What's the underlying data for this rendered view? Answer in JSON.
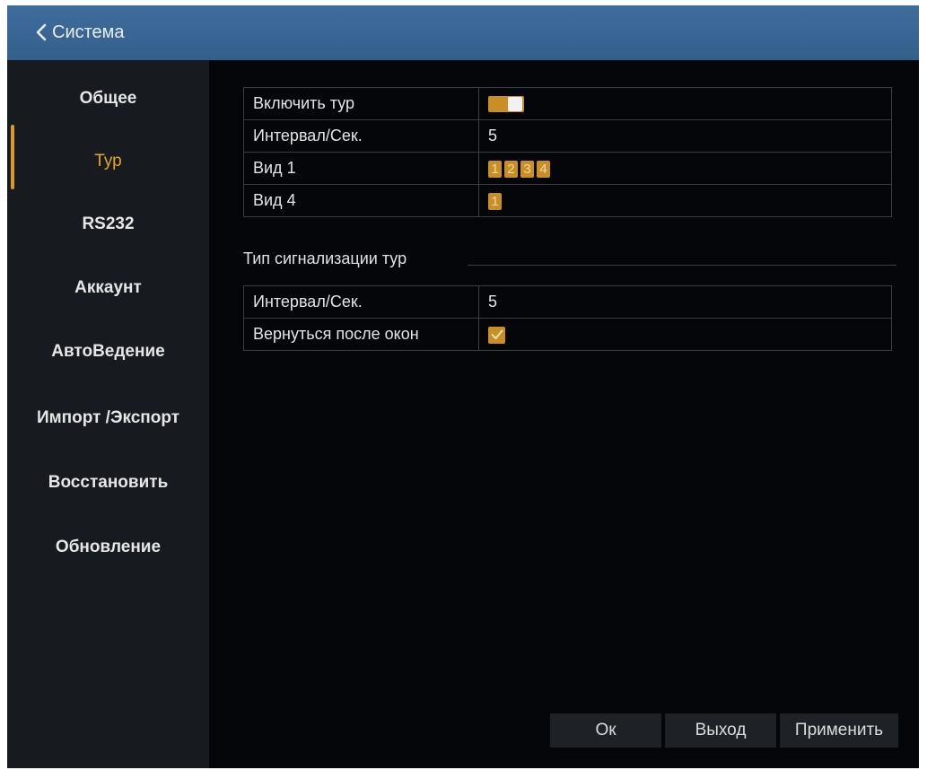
{
  "title_bar": {
    "back_icon": "chevron-left-icon",
    "title": "Система"
  },
  "sidebar": {
    "active_color": "#e3a52a",
    "items": [
      {
        "label": "Общее",
        "active": false
      },
      {
        "label": "Тур",
        "active": true
      },
      {
        "label": "RS232",
        "active": false
      },
      {
        "label": "Аккаунт",
        "active": false
      },
      {
        "label": "АвтоВедение",
        "active": false
      },
      {
        "label": "Импорт /Экспорт",
        "active": false
      },
      {
        "label": "Восстановить",
        "active": false
      },
      {
        "label": "Обновление",
        "active": false
      }
    ]
  },
  "tour": {
    "enable": {
      "label": "Включить тур",
      "on": true
    },
    "interval": {
      "label": "Интервал/Сек.",
      "value": "5"
    },
    "view1": {
      "label": "Вид 1",
      "channels": [
        "1",
        "2",
        "3",
        "4"
      ]
    },
    "view4": {
      "label": "Вид 4",
      "channels": [
        "1"
      ]
    }
  },
  "alarm_tour": {
    "title": "Тип сигнализации тур",
    "interval": {
      "label": "Интервал/Сек.",
      "value": "5"
    },
    "return_after": {
      "label": "Вернуться после окон",
      "checked": true,
      "icon": "check-icon"
    }
  },
  "footer": {
    "ok_label": "Ок",
    "exit_label": "Выход",
    "apply_label": "Применить"
  },
  "colors": {
    "accent": "#c98f24",
    "titlebar": "#3a6795",
    "sidebar_bg": "#171a1f",
    "main_bg": "#04060a"
  }
}
